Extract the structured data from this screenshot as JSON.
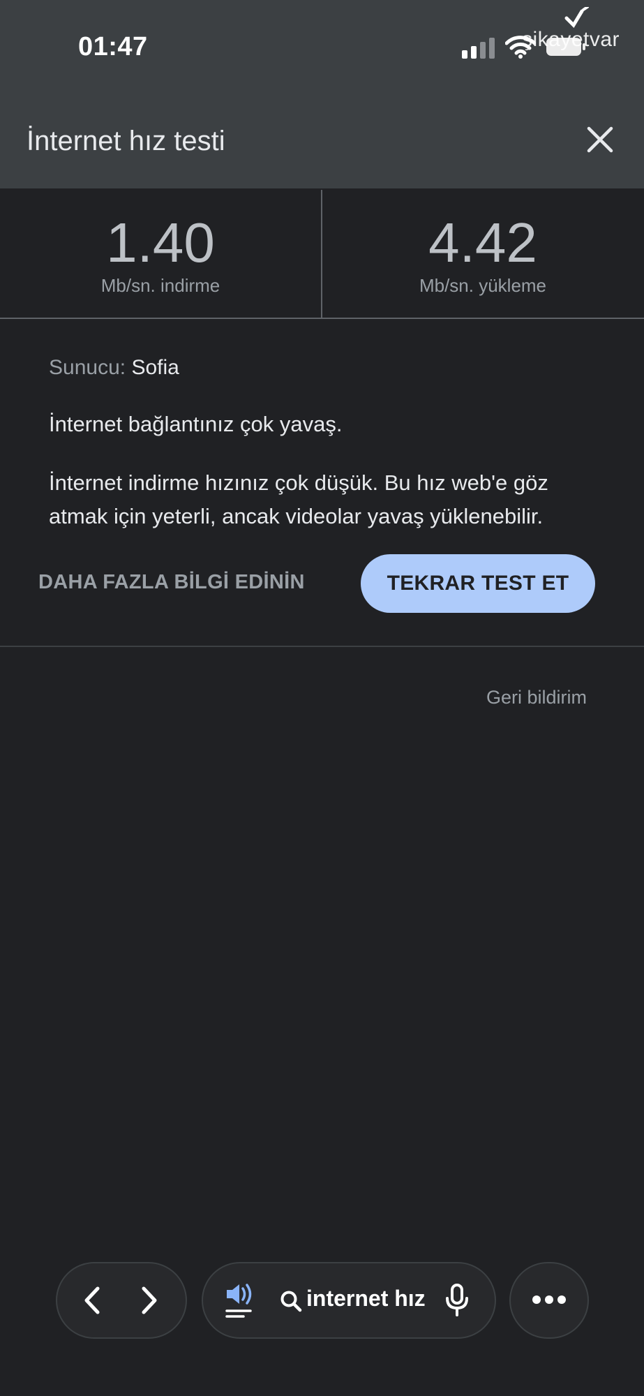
{
  "status_bar": {
    "time": "01:47",
    "watermark": "şikayetvar",
    "icons": [
      "cellular-signal-icon",
      "wifi-icon",
      "battery-icon"
    ]
  },
  "header": {
    "title": "İnternet hız testi",
    "close_icon": "close-icon"
  },
  "results": {
    "download": {
      "value": "1.40",
      "unit": "Mb/sn. indirme"
    },
    "upload": {
      "value": "4.42",
      "unit": "Mb/sn. yükleme"
    }
  },
  "info": {
    "server_label": "Sunucu:",
    "server_name": "Sofia",
    "summary": "İnternet bağlantınız çok yavaş.",
    "detail": "İnternet indirme hızınız çok düşük. Bu hız web'e göz atmak için yeterli, ancak videolar yavaş yüklenebilir."
  },
  "actions": {
    "learn_more": "DAHA FAZLA BİLGİ EDİNİN",
    "retest": "TEKRAR TEST ET"
  },
  "feedback": "Geri bildirim",
  "toolbar": {
    "back_icon": "chevron-left-icon",
    "forward_icon": "chevron-right-icon",
    "listen_icon": "read-aloud-icon",
    "search_icon": "search-icon",
    "query": "internet hız",
    "mic_icon": "microphone-icon",
    "more_icon": "more-horizontal-icon"
  },
  "colors": {
    "background": "#202124",
    "header": "#3c4043",
    "accent_button": "#aecbfa",
    "listen_icon": "#8ab4f8"
  }
}
